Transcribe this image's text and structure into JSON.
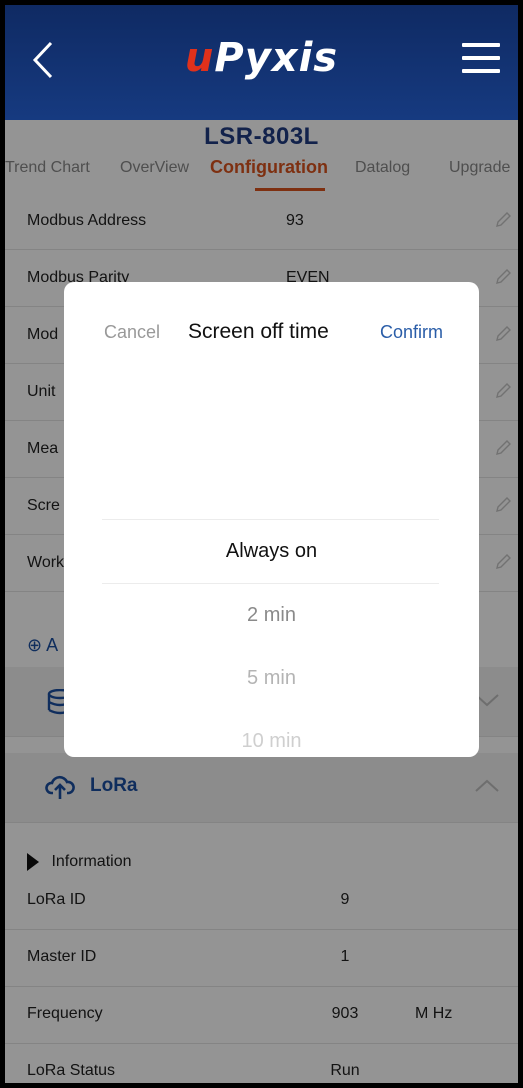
{
  "header": {
    "logo_u": "u",
    "logo_rest": "Pyxis"
  },
  "device": {
    "title": "LSR-803L"
  },
  "tabs": [
    {
      "label": "Trend Chart"
    },
    {
      "label": "OverView"
    },
    {
      "label": "Configuration"
    },
    {
      "label": "Datalog"
    },
    {
      "label": "Upgrade"
    }
  ],
  "config_rows": [
    {
      "label": "Modbus Address",
      "value": "93"
    },
    {
      "label": "Modbus Parity",
      "value": "EVEN"
    },
    {
      "label": "Mod",
      "value": ""
    },
    {
      "label": "Unit",
      "value": ""
    },
    {
      "label": "Mea",
      "value": ""
    },
    {
      "label": "Scre",
      "value": ""
    },
    {
      "label": "Work",
      "value": ""
    }
  ],
  "add_link": "A",
  "sections": {
    "lora_title": "LoRa"
  },
  "information": {
    "heading": "Information",
    "rows": [
      {
        "label": "LoRa ID",
        "value": "9",
        "unit": ""
      },
      {
        "label": "Master ID",
        "value": "1",
        "unit": ""
      },
      {
        "label": "Frequency",
        "value": "903",
        "unit": "M Hz"
      },
      {
        "label": "LoRa Status",
        "value": "Run",
        "unit": ""
      }
    ]
  },
  "picker": {
    "cancel": "Cancel",
    "title": "Screen off time",
    "confirm": "Confirm",
    "selected": "Always on",
    "options": [
      "2 min",
      "5 min",
      "10 min"
    ]
  },
  "colors": {
    "header": "#163a80",
    "accent": "#d9541e",
    "link": "#1a4fa0"
  }
}
